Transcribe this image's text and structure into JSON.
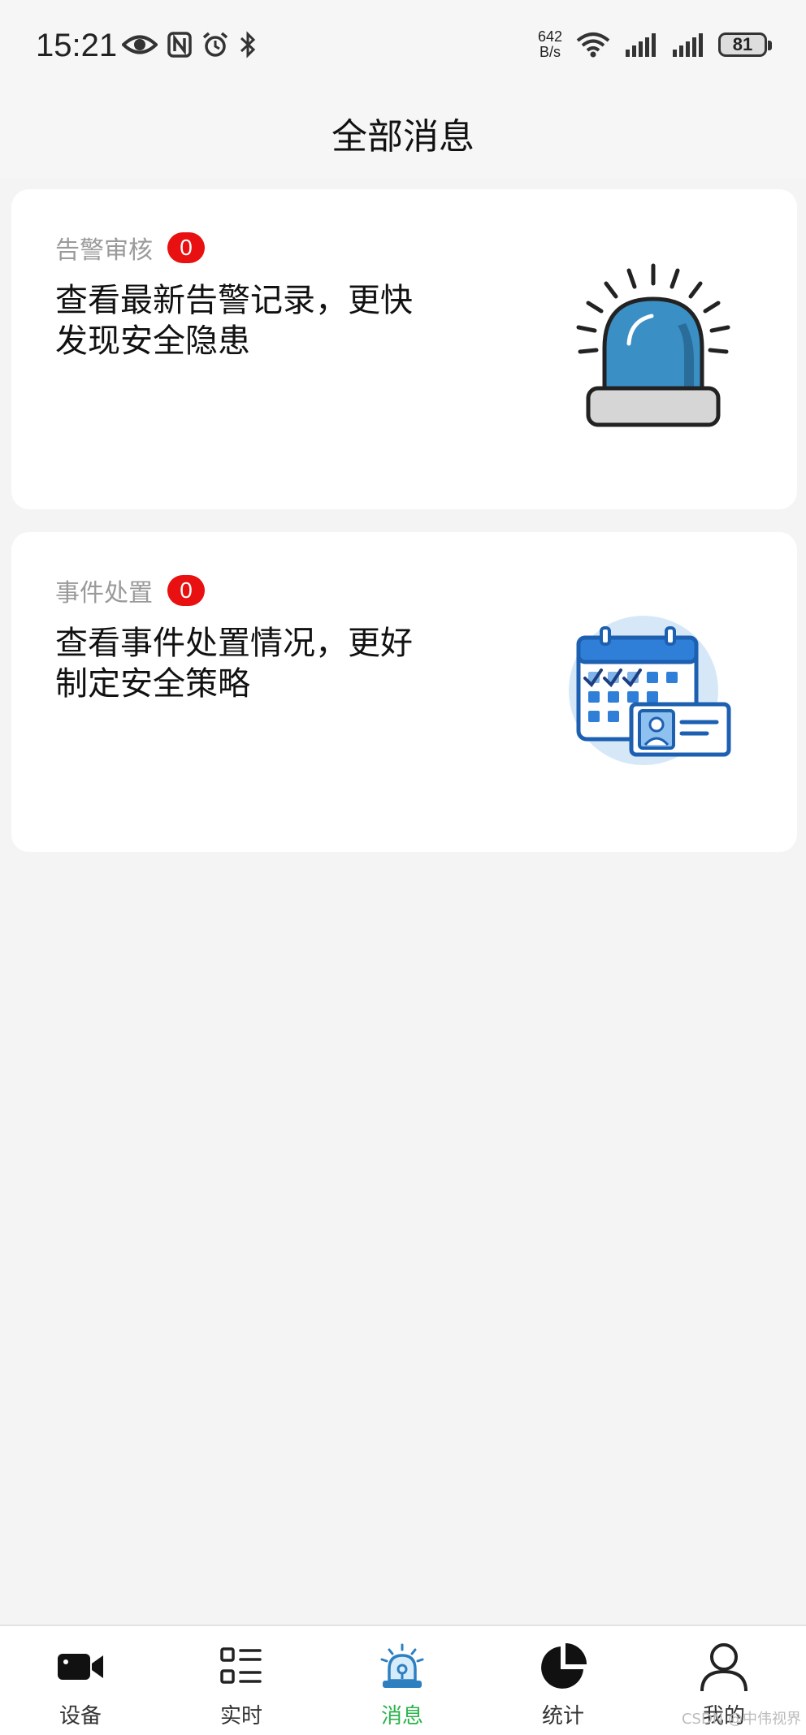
{
  "status_bar": {
    "time": "15:21",
    "network_speed_value": "642",
    "network_speed_unit": "B/s",
    "battery": "81",
    "icons_left": [
      "eye-icon",
      "nfc-icon",
      "alarm-icon",
      "bluetooth-icon"
    ],
    "icons_right": [
      "wifi-icon",
      "signal-icon",
      "signal-icon"
    ]
  },
  "header": {
    "title": "全部消息"
  },
  "cards": [
    {
      "label": "告警审核",
      "count": "0",
      "desc_line1": "查看最新告警记录，更快",
      "desc_line2": "发现安全隐患",
      "icon": "alarm-siren-icon"
    },
    {
      "label": "事件处置",
      "count": "0",
      "desc_line1": "查看事件处置情况，更好",
      "desc_line2": "制定安全策略",
      "icon": "calendar-id-card-icon"
    }
  ],
  "tabbar": {
    "active_color": "#2bb24c",
    "items": [
      {
        "label": "设备",
        "icon": "video-camera-icon"
      },
      {
        "label": "实时",
        "icon": "list-icon"
      },
      {
        "label": "消息",
        "icon": "siren-icon",
        "active": true
      },
      {
        "label": "统计",
        "icon": "pie-chart-icon"
      },
      {
        "label": "我的",
        "icon": "user-icon"
      }
    ]
  },
  "watermark": "CSDN @中伟视界",
  "colors": {
    "badge": "#e81010",
    "siren_blue": "#3a8fc4",
    "calendar_blue": "#2f7fd8"
  }
}
